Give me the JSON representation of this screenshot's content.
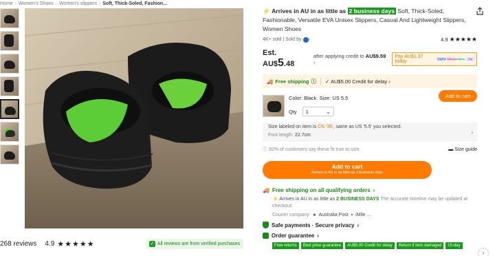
{
  "breadcrumb": {
    "items": [
      "Home",
      "Women's Shoes",
      "Women's slippers"
    ],
    "current": "Soft, Thick-Soled, Fashion..."
  },
  "product": {
    "arrives_prefix": "Arrives in AU in as little as",
    "arrives_highlight": "2 business days",
    "title_rest": "Soft, Thick-Soled, Fashionable, Versatile EVA Unisex Slippers, Casual And Lightweight Slippers, Women Shoes",
    "sold": "4K+ sold",
    "sold_by": "Sold by",
    "rating": "4.9",
    "stars": "★★★★★"
  },
  "price": {
    "est_prefix": "Est. AU$",
    "est_main": "5",
    "est_cents": ".48",
    "after_text": "after applying credit to",
    "after_value": "AU$9.59",
    "paylater": "Pay AU$1.37 today",
    "paylater_logos": [
      "PayPal",
      "Afterpay",
      "Klarna",
      "Zip"
    ]
  },
  "shipping_band": {
    "free": "Free shipping",
    "credit": "AU$5.00 Credit for delay"
  },
  "variant": {
    "color_label": "Color: Black. Size: US 5.5",
    "qty_label": "Qty",
    "qty_value": "1",
    "add_small": "Add to cart"
  },
  "size_box": {
    "line_prefix": "Size labeled on item is",
    "cn": "CN '36'",
    "line_suffix": ", same as US '5.5' you selected.",
    "foot_label": "Foot length:",
    "foot_value": "22.7cm"
  },
  "fit": {
    "text": "92% of customers say these fit true to size",
    "size_guide": "Size guide"
  },
  "add_big": {
    "label": "Add to cart",
    "sub": "Arrives in AU in as little as 2 business days"
  },
  "ship_info": {
    "head": "Free shipping on all qualifying orders",
    "sub_prefix": "Arrives in AU in as little as",
    "sub_bold": "2 BUSINESS DAYS",
    "sub_muted": "The accurate timeline may be updated at checkout.",
    "courier_label": "Courier company:",
    "couriers": [
      "Australia Post",
      "iMile ..."
    ]
  },
  "safe_payments": "Safe payments · Secure privacy",
  "order_guarantee": {
    "label": "Order guarantee",
    "tags": [
      "Free returns",
      "Best price guarantee",
      "AU$5.00 Credit for delay",
      "Return if item damaged",
      "15-day"
    ]
  },
  "reviews": {
    "count": "268 reviews",
    "rating": "4.9",
    "stars": "★★★★★",
    "verified": "All reviews are from verified purchases"
  },
  "colors": {
    "accent_orange": "#ff7a00",
    "green": "#1a8a1a"
  }
}
